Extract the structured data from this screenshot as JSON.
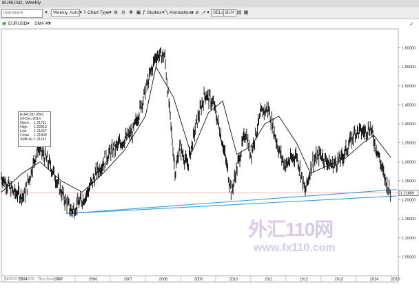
{
  "window": {
    "title": "EURUSD, Weekly"
  },
  "toolbar": {
    "instrument_placeholder": "Instrument",
    "interval": "Weekly, Auto",
    "chart_type": "Chart Type",
    "studies": "Studies",
    "annotations": "Annotations",
    "sell": "SELL",
    "buy": "BUY"
  },
  "legend": {
    "symbol": "EURUSD",
    "study": "SMA 40"
  },
  "tooltip": {
    "title": "EURUSD (Bid)",
    "date": "29-Dec-2014",
    "rows": [
      {
        "label": "Open",
        "value": "1.21711"
      },
      {
        "label": "High",
        "value": "1.22013"
      },
      {
        "label": "Low",
        "value": "1.21667"
      },
      {
        "label": "Close",
        "value": "1.21809"
      },
      {
        "label": "SMA 40",
        "value": "1.31147"
      }
    ]
  },
  "footer_note": "INDICATIVE PRICE · Time Zone: GMT",
  "watermark": {
    "cn": "外汇110网",
    "url": "www.fx110.com"
  },
  "colors": {
    "bars": "#000000",
    "sma": "#111111",
    "trendline": "#3a9ad9",
    "priceline": "#f08c8c",
    "last_price_bg": "#ffffff"
  },
  "chart_data": {
    "type": "line",
    "title": "EURUSD, Weekly",
    "series": [
      {
        "name": "EURUSD",
        "x": [
          2003.9,
          2004.25,
          2004.55,
          2004.95,
          2005.3,
          2005.7,
          2005.9,
          2006.3,
          2006.6,
          2006.95,
          2007.3,
          2007.65,
          2007.95,
          2008.3,
          2008.55,
          2008.7,
          2008.85,
          2008.98,
          2009.2,
          2009.45,
          2009.7,
          2009.95,
          2010.2,
          2010.45,
          2010.6,
          2010.85,
          2011.0,
          2011.3,
          2011.5,
          2011.8,
          2011.98,
          2012.3,
          2012.55,
          2012.75,
          2012.98,
          2013.3,
          2013.6,
          2013.98,
          2014.25,
          2014.4,
          2014.6,
          2014.8,
          2014.99
        ],
        "values": [
          1.26,
          1.22,
          1.21,
          1.34,
          1.29,
          1.2,
          1.17,
          1.21,
          1.27,
          1.32,
          1.35,
          1.38,
          1.47,
          1.58,
          1.58,
          1.42,
          1.27,
          1.34,
          1.29,
          1.4,
          1.48,
          1.45,
          1.35,
          1.22,
          1.28,
          1.38,
          1.32,
          1.43,
          1.44,
          1.33,
          1.29,
          1.32,
          1.22,
          1.3,
          1.32,
          1.29,
          1.31,
          1.38,
          1.38,
          1.39,
          1.33,
          1.26,
          1.218
        ]
      },
      {
        "name": "SMA 40",
        "x": [
          2003.9,
          2004.5,
          2005.0,
          2005.6,
          2006.2,
          2006.8,
          2007.4,
          2008.0,
          2008.3,
          2008.8,
          2009.3,
          2009.8,
          2010.2,
          2010.6,
          2011.0,
          2011.4,
          2011.8,
          2012.3,
          2012.7,
          2013.2,
          2013.7,
          2014.2,
          2014.5,
          2014.99
        ],
        "values": [
          1.22,
          1.27,
          1.3,
          1.25,
          1.22,
          1.27,
          1.33,
          1.42,
          1.55,
          1.47,
          1.32,
          1.43,
          1.46,
          1.32,
          1.34,
          1.4,
          1.42,
          1.35,
          1.27,
          1.29,
          1.31,
          1.35,
          1.37,
          1.311
        ]
      }
    ],
    "trendlines": [
      {
        "x": [
          2005.8,
          2015.15
        ],
        "values": [
          1.164,
          1.227
        ]
      },
      {
        "x": [
          2005.8,
          2015.15
        ],
        "values": [
          1.164,
          1.21
        ]
      }
    ],
    "price_line": 1.21809,
    "last_price_label": "1.21809",
    "ylim": [
      1.0,
      1.65
    ],
    "yticks": [
      1.05,
      1.1,
      1.15,
      1.2,
      1.25,
      1.3,
      1.35,
      1.4,
      1.45,
      1.5,
      1.55,
      1.6
    ],
    "ytick_labels": [
      "1.05000",
      "1.10000",
      "1.15000",
      "1.20000",
      "1.25000",
      "1.30000",
      "1.35000",
      "1.40000",
      "1.45000",
      "1.50000",
      "1.55000",
      "1.60000"
    ],
    "xlim": [
      2003.9,
      2015.2
    ],
    "xticks": [
      2004,
      2005,
      2006,
      2007,
      2008,
      2009,
      2010,
      2011,
      2012,
      2013,
      2014,
      2015
    ],
    "xtick_labels": [
      "2004",
      "2005",
      "2006",
      "2007",
      "2008",
      "2009",
      "2010",
      "2011",
      "2012",
      "2013",
      "2014",
      "2015"
    ],
    "grid": false
  }
}
